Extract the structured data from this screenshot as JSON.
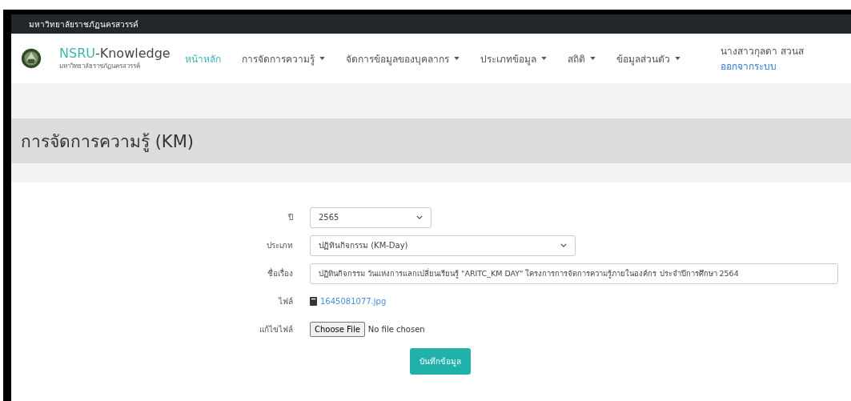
{
  "topbar": {
    "title": "มหาวิทยาลัยราชภัฏนครสวรรค์"
  },
  "navbar": {
    "brand": {
      "name_part_1": "NSRU",
      "name_part_2": "-Knowledge",
      "subtitle": "มหาวิทยาลัยราชภัฏนครสวรรค์"
    },
    "items": [
      {
        "label": "หน้าหลัก",
        "selected": true,
        "dropdown": false
      },
      {
        "label": "การจัดการความรู้",
        "selected": false,
        "dropdown": true
      },
      {
        "label": "จัดการข้อมูลของบุคลากร",
        "selected": false,
        "dropdown": true
      },
      {
        "label": "ประเภทข้อมูล",
        "selected": false,
        "dropdown": true
      },
      {
        "label": "สถิติ",
        "selected": false,
        "dropdown": true
      },
      {
        "label": "ข้อมูลส่วนตัว",
        "selected": false,
        "dropdown": true
      }
    ],
    "user": {
      "name": "นางสาวกุลดา สวนส",
      "logout": "ออกจากระบบ"
    }
  },
  "page_header": {
    "title": "การจัดการความรู้ (KM)"
  },
  "form": {
    "fields": [
      {
        "kind": "select",
        "label": "ปี",
        "value": "2565"
      },
      {
        "kind": "select",
        "label": "ประเภท",
        "value": "ปฏิทินกิจกรรม (KM-Day)"
      },
      {
        "kind": "text",
        "label": "ชื่อเรื่อง",
        "value": "ปฏิทินกิจกรรม วันแห่งการแลกเปลี่ยนเรียนรู้ \"ARITC_KM DAY\" โครงการการจัดการความรู้ภายในองค์กร ประจำปีการศึกษา 2564"
      },
      {
        "kind": "file_link",
        "label": "ไฟล์",
        "value": "1645081077.jpg"
      },
      {
        "kind": "file_input",
        "label": "แก้ไขไฟล์",
        "button": "Choose File",
        "value": "No file chosen"
      }
    ],
    "submit": "บันทึกข้อมูล"
  }
}
